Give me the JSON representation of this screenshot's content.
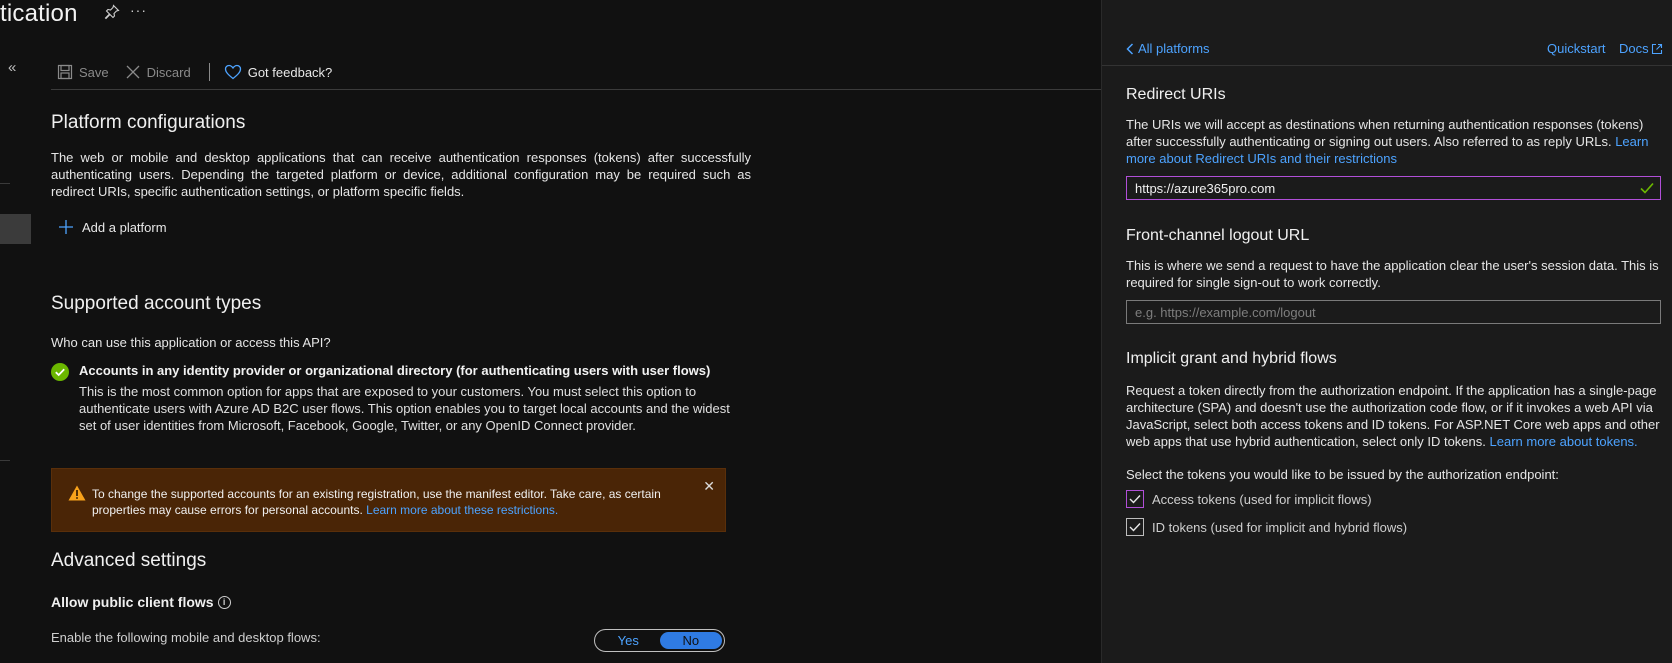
{
  "header": {
    "title": "tication",
    "more_label": "···"
  },
  "sidebar": {
    "collapse_label": "«"
  },
  "toolbar": {
    "save_label": "Save",
    "discard_label": "Discard",
    "feedback_label": "Got feedback?"
  },
  "platform": {
    "title": "Platform configurations",
    "description": "The web or mobile and desktop applications that can receive authentication responses (tokens) after successfully authenticating users. Depending the targeted platform or device, additional configuration may be required such as redirect URIs, specific authentication settings, or platform specific fields.",
    "add_label": "Add a platform"
  },
  "accounts": {
    "title": "Supported account types",
    "question": "Who can use this application or access this API?",
    "option_label": "Accounts in any identity provider or organizational directory (for authenticating users with user flows)",
    "option_description": "This is the most common option for apps that are exposed to your customers. You must select this option to authenticate users with Azure AD B2C user flows. This option enables you to target local accounts and the widest set of user identities from Microsoft, Facebook, Google, Twitter, or any OpenID Connect provider.",
    "warning_text": "To change the supported accounts for an existing registration, use the manifest editor. Take care, as certain properties may cause errors for personal accounts.",
    "warning_link": "Learn more about these restrictions.",
    "warning_close": "✕"
  },
  "advanced": {
    "title": "Advanced settings",
    "allow_label": "Allow public client flows",
    "flows_label": "Enable the following mobile and desktop flows:",
    "yes_label": "Yes",
    "no_label": "No",
    "selected": "No"
  },
  "panel": {
    "back_label": "All platforms",
    "quickstart_label": "Quickstart",
    "docs_label": "Docs",
    "redirect": {
      "title": "Redirect URIs",
      "text": "The URIs we will accept as destinations when returning authentication responses (tokens) after successfully authenticating or signing out users. Also referred to as reply URLs.",
      "link": "Learn more about Redirect URIs and their restrictions",
      "value": "https://azure365pro.com"
    },
    "logout": {
      "title": "Front-channel logout URL",
      "text": "This is where we send a request to have the application clear the user's session data. This is required for single sign-out to work correctly.",
      "placeholder": "e.g. https://example.com/logout"
    },
    "implicit": {
      "title": "Implicit grant and hybrid flows",
      "text": "Request a token directly from the authorization endpoint. If the application has a single-page architecture (SPA) and doesn't use the authorization code flow, or if it invokes a web API via JavaScript, select both access tokens and ID tokens. For ASP.NET Core web apps and other web apps that use hybrid authentication, select only ID tokens.",
      "link": "Learn more about tokens.",
      "select_label": "Select the tokens you would like to be issued by the authorization endpoint:",
      "access_label": "Access tokens (used for implicit flows)",
      "access_checked": true,
      "id_label": "ID tokens (used for implicit and hybrid flows)",
      "id_checked": true
    }
  },
  "colors": {
    "accent": "#4da3ff",
    "success": "#6bb700",
    "warning_bg": "#4a2506",
    "focus": "#b14fd8"
  }
}
